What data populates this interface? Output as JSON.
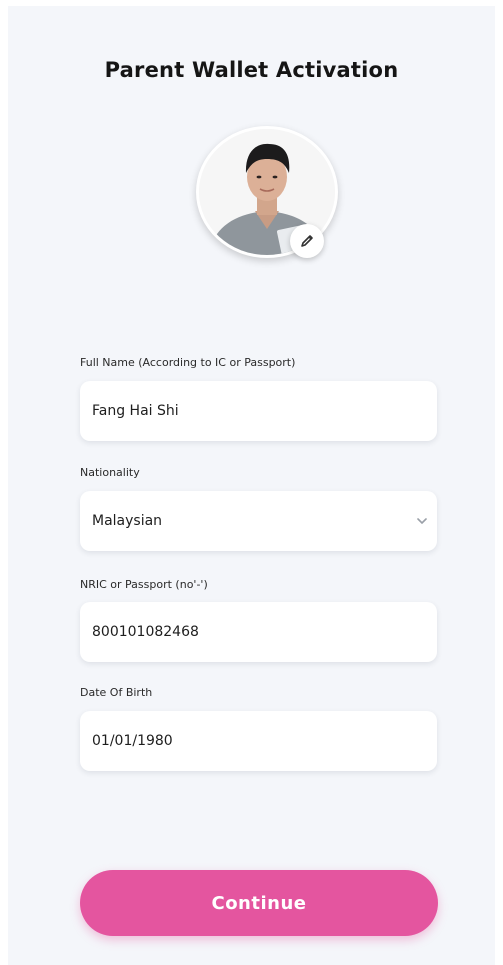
{
  "header": {
    "title": "Parent Wallet Activation"
  },
  "profile": {
    "avatar_icon": "person-photo",
    "edit_icon": "pencil-icon"
  },
  "form": {
    "full_name": {
      "label": "Full Name (According to IC or Passport)",
      "value": "Fang Hai Shi"
    },
    "nationality": {
      "label": "Nationality",
      "value": "Malaysian",
      "icon": "chevron-down-icon"
    },
    "nric": {
      "label": "NRIC or Passport (no'-')",
      "value": "800101082468"
    },
    "dob": {
      "label": "Date Of Birth",
      "value": "01/01/1980"
    }
  },
  "actions": {
    "continue_label": "Continue"
  },
  "colors": {
    "accent": "#e4559f",
    "background": "#f4f6fa",
    "field_background": "#ffffff"
  }
}
